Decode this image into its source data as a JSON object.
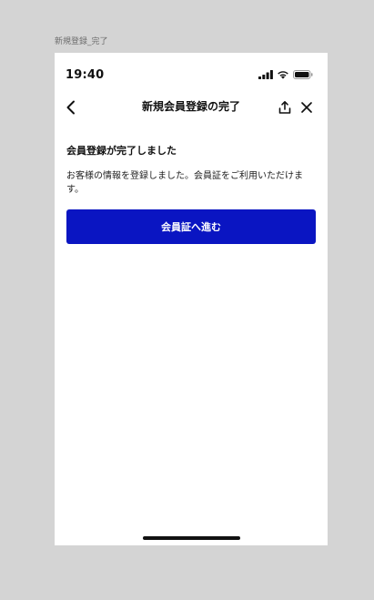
{
  "frame": {
    "label": "新規登録_完了"
  },
  "status_bar": {
    "time": "19:40",
    "icons": [
      "cellular-signal-icon",
      "wifi-icon",
      "battery-icon"
    ]
  },
  "nav": {
    "title": "新規会員登録の完了",
    "icons": [
      "chevron-left-icon",
      "share-icon",
      "close-icon"
    ]
  },
  "content": {
    "heading": "会員登録が完了しました",
    "message": "お客様の情報を登録しました。会員証をご利用いただけます。",
    "button_label": "会員証へ進む"
  },
  "colors": {
    "primary": "#0a15c2",
    "background": "#d4d4d4",
    "surface": "#ffffff"
  }
}
